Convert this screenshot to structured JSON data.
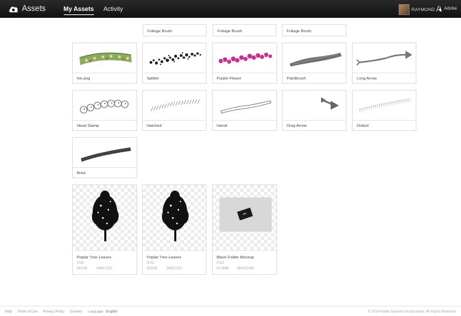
{
  "header": {
    "app_title": "Assets",
    "tabs": [
      {
        "label": "My Assets",
        "active": true
      },
      {
        "label": "Activity",
        "active": false
      }
    ],
    "user_name": "RAYMOND",
    "brand_label": "Adobe"
  },
  "top_row": [
    {
      "title": "Foliage Brush"
    },
    {
      "title": "Foliage Brush"
    },
    {
      "title": "Foliage Brush"
    }
  ],
  "brushes": [
    {
      "title": "foo.png",
      "icon": "foo-png-brush-icon"
    },
    {
      "title": "Splitter",
      "icon": "splitter-brush-icon"
    },
    {
      "title": "Purple Flower",
      "icon": "purple-flower-brush-icon"
    },
    {
      "title": "Paintbrush",
      "icon": "paintbrush-brush-icon"
    },
    {
      "title": "Long Arrow",
      "icon": "long-arrow-brush-icon"
    },
    {
      "title": "Head Stamp",
      "icon": "head-stamp-brush-icon"
    },
    {
      "title": "Hatched",
      "icon": "hatched-brush-icon"
    },
    {
      "title": "Handi",
      "icon": "handi-brush-icon"
    },
    {
      "title": "Drag Arrow",
      "icon": "drag-arrow-brush-icon"
    },
    {
      "title": "Dotted",
      "icon": "dotted-brush-icon"
    },
    {
      "title": "Brick",
      "icon": "brick-brush-icon"
    }
  ],
  "assets": [
    {
      "title": "Poplar Tree Leaves",
      "type": "SVG",
      "size": "821KB",
      "dims": "848X1201"
    },
    {
      "title": "Poplar Tree Leaves",
      "type": "SVG",
      "size": "821KB",
      "dims": "848X1201"
    },
    {
      "title": "Black Folder Mockup",
      "type": "PSD",
      "size": "51.9MB",
      "dims": "3840X2400"
    }
  ],
  "footer": {
    "links": [
      "Help",
      "Terms of Use",
      "Privacy Policy",
      "Cookies",
      "Language:"
    ],
    "language": "English",
    "copyright": "© 2014 Adobe Systems Incorporated. All Rights Reserved."
  }
}
